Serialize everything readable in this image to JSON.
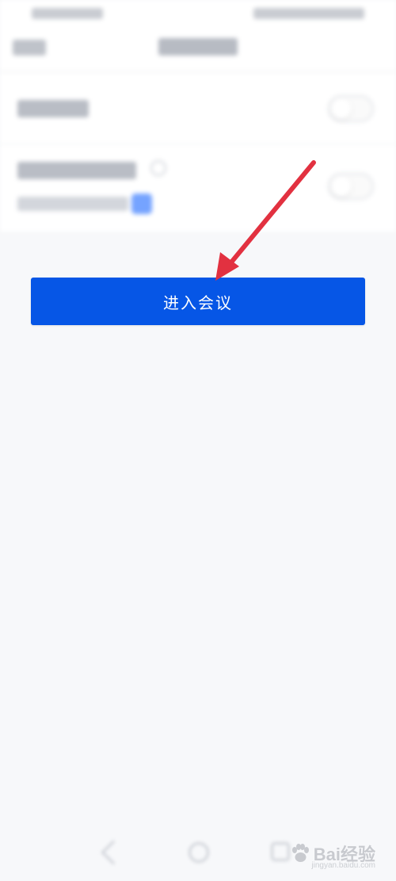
{
  "main": {
    "enter_button_label": "进入会议"
  },
  "colors": {
    "primary": "#0656e6",
    "background": "#f7f8fa",
    "annotation_arrow": "#e23140"
  },
  "icons": {
    "help": "help-icon",
    "copy": "copy-icon",
    "annotation": "arrow-icon"
  },
  "watermark": {
    "text": "Bai经验",
    "url": "jingyan.baidu.com"
  }
}
